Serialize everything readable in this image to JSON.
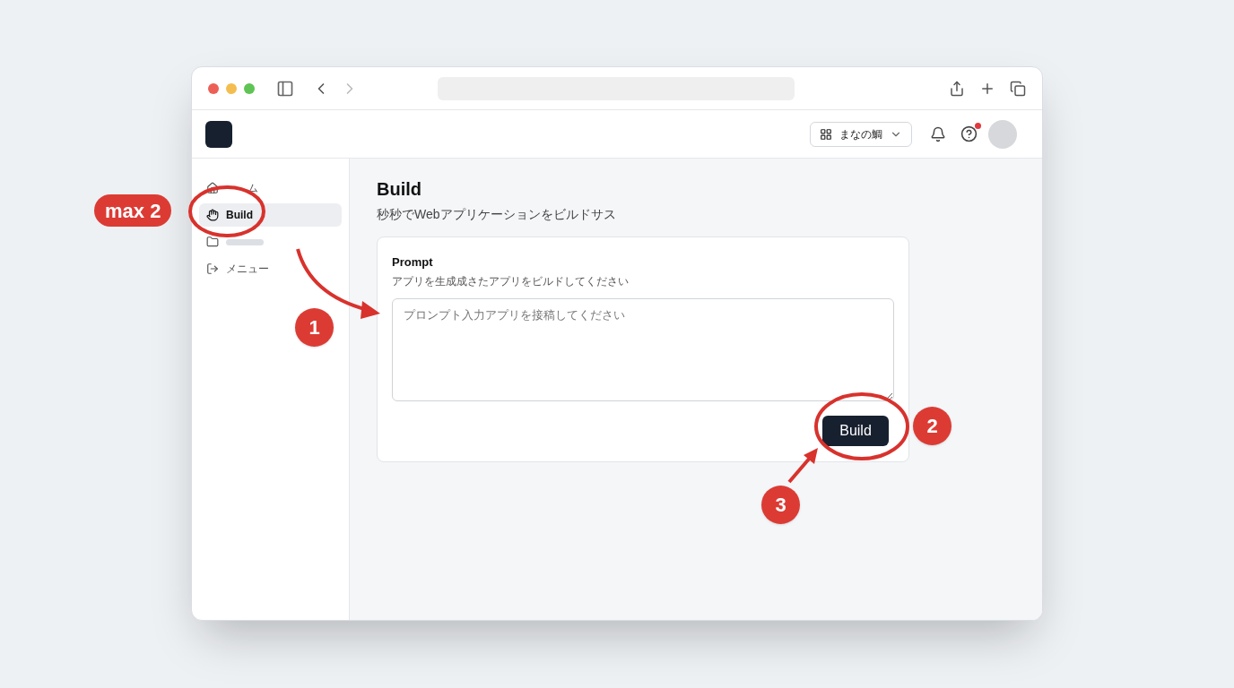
{
  "header": {
    "workspace": "まなの鯛"
  },
  "notifications": {
    "help_badge": true
  },
  "sidebar": {
    "items": [
      {
        "kind": "home",
        "label": "ム",
        "selected": false
      },
      {
        "kind": "build",
        "label": "Build",
        "selected": true
      },
      {
        "kind": "blank",
        "selected": false
      },
      {
        "kind": "logout",
        "label": "メニュー",
        "selected": false
      }
    ]
  },
  "page": {
    "title": "Build",
    "subtitle": "秒秒でWebアプリケーションをビルドサス"
  },
  "prompt_card": {
    "label": "Prompt",
    "description": "アプリを生成成さたアプリをビルドしてください",
    "placeholder": "プロンプト入力アプリを接稿してください",
    "button": "Build"
  },
  "annotations": {
    "tag": "max 2",
    "steps": [
      "1",
      "2",
      "3"
    ]
  }
}
